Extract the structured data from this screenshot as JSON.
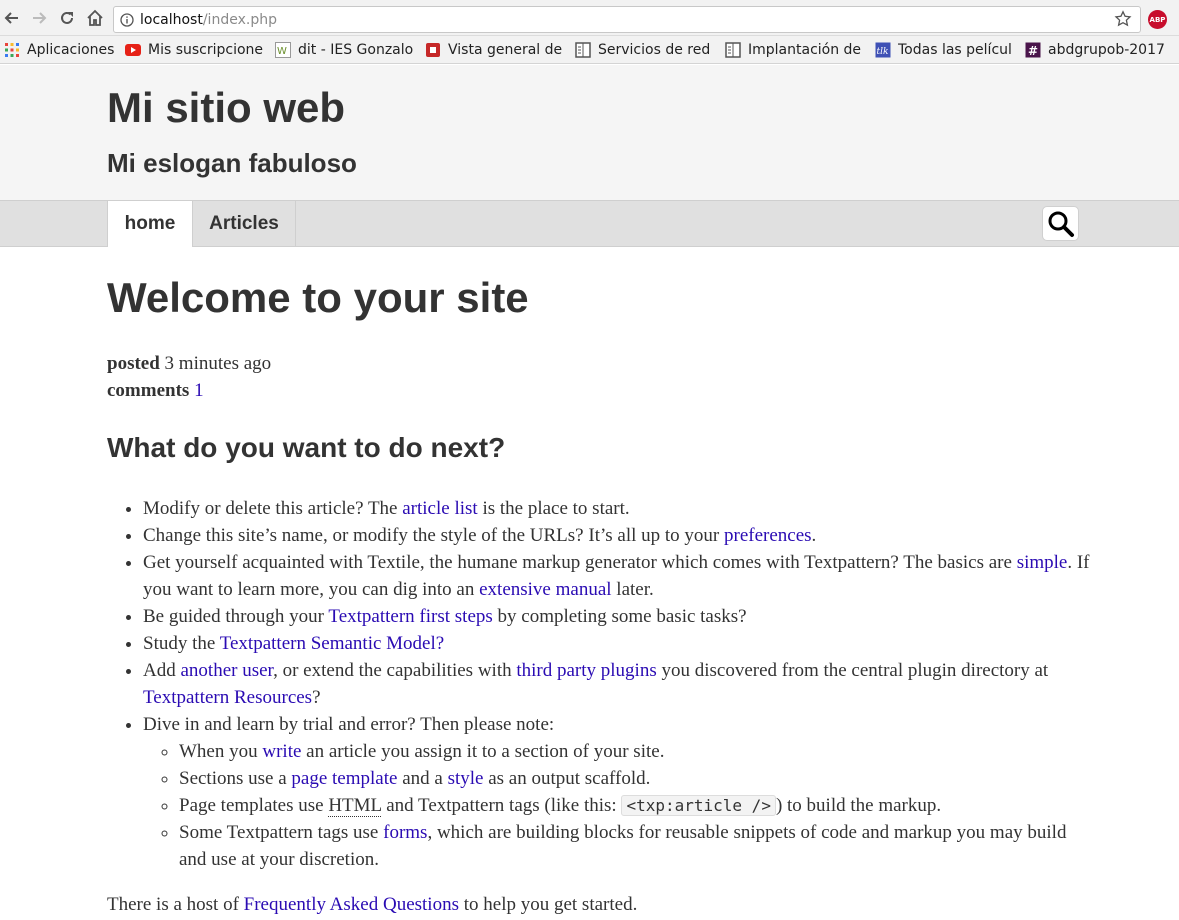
{
  "browser": {
    "url_host": "localhost",
    "url_path": "/index.php",
    "extension_badge": "ABP",
    "bookmarks": [
      {
        "label": "Aplicaciones",
        "icon": "apps-grid-icon",
        "color": "#e8453c"
      },
      {
        "label": "Mis suscripcione",
        "icon": "youtube-icon",
        "color": "#e62117"
      },
      {
        "label": "dit - IES Gonzalo",
        "icon": "wiki-icon",
        "color": "#6a8f2c"
      },
      {
        "label": "Vista general de",
        "icon": "red-square-icon",
        "color": "#c62828"
      },
      {
        "label": "Servicios de red",
        "icon": "document-icon",
        "color": "#555555"
      },
      {
        "label": "Implantación de",
        "icon": "document-icon",
        "color": "#555555"
      },
      {
        "label": "Todas las películ",
        "icon": "film-icon",
        "color": "#3f51b5"
      },
      {
        "label": "abdgrupob-2017",
        "icon": "slack-hash-icon",
        "color": "#4a154b"
      }
    ]
  },
  "site": {
    "title": "Mi sitio web",
    "slogan": "Mi eslogan fabuloso",
    "nav": [
      {
        "label": "home"
      },
      {
        "label": "Articles"
      }
    ]
  },
  "article": {
    "title": "Welcome to your site",
    "posted_label": "posted",
    "posted_value": "3 minutes ago",
    "comments_label": "comments",
    "comments_value": "1",
    "heading": "What do you want to do next?",
    "items": {
      "i1_pre": "Modify or delete this article? The ",
      "i1_link": "article list",
      "i1_post": " is the place to start.",
      "i2_pre": "Change this site’s name, or modify the style of the URLs? It’s all up to your ",
      "i2_link": "preferences",
      "i2_post": ".",
      "i3_pre": "Get yourself acquainted with Textile, the humane markup generator which comes with Textpattern? The basics are ",
      "i3_link1": "simple",
      "i3_mid": ". If you want to learn more, you can dig into an ",
      "i3_link2": "extensive manual",
      "i3_post": " later.",
      "i4_pre": "Be guided through your ",
      "i4_link": "Textpattern first steps",
      "i4_post": " by completing some basic tasks?",
      "i5_pre": "Study the ",
      "i5_link": "Textpattern Semantic Model?",
      "i6_pre": "Add ",
      "i6_link1": "another user",
      "i6_mid": ", or extend the capabilities with ",
      "i6_link2": "third party plugins",
      "i6_mid2": " you discovered from the central plugin directory at ",
      "i6_link3": "Textpattern Resources",
      "i6_post": "?",
      "i7": "Dive in and learn by trial and error? Then please note:",
      "s1_pre": "When you ",
      "s1_link": "write",
      "s1_post": " an article you assign it to a section of your site.",
      "s2_pre": "Sections use a ",
      "s2_link1": "page template",
      "s2_mid": " and a ",
      "s2_link2": "style",
      "s2_post": " as an output scaffold.",
      "s3_pre": "Page templates use ",
      "s3_abbr": "HTML",
      "s3_mid": " and Textpattern tags (like this: ",
      "s3_code": "<txp:article />",
      "s3_post": ") to build the markup.",
      "s4_pre": "Some Textpattern tags use ",
      "s4_link": "forms",
      "s4_post": ", which are building blocks for reusable snippets of code and markup you may build and use at your discretion."
    },
    "footer_pre": "There is a host of ",
    "footer_link": "Frequently Asked Questions",
    "footer_post": " to help you get started."
  },
  "colors": {
    "link": "#2a0bb3",
    "text": "#333333",
    "header_bg": "#f5f5f5",
    "nav_bg": "#e0e0e0"
  }
}
